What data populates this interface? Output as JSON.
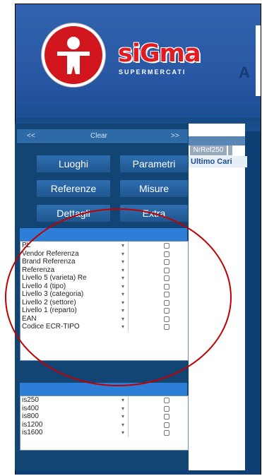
{
  "brand": {
    "name": "siGma",
    "tagline": "SUPERMERCATI"
  },
  "header_right_fragment": "A",
  "top_bar": {
    "prev": "<<",
    "clear": "Clear",
    "next": ">>"
  },
  "buttons": {
    "luoghi": "Luoghi",
    "parametri": "Parametri",
    "referenze": "Referenze",
    "misure": "Misure",
    "dettagli": "Dettagli",
    "extra": "Extra"
  },
  "dimensions": [
    "PL",
    "Vendor Referenza",
    "Brand Referenza",
    "Referenza",
    "Livello 5 (varieta) Re",
    "Livello 4 (tipo)",
    "Livello 3 (categoria)",
    "Livello 2 (settore)",
    "Livello 1 (reparto)",
    "EAN",
    "Codice ECR-TIPO"
  ],
  "measures": [
    "is250",
    "is400",
    "is800",
    "is1200",
    "is1600"
  ],
  "right_tab": "NrRef250",
  "right_sub": "Ultimo Cari",
  "colors": {
    "panel": "#124573",
    "button": "#2a639f",
    "accent_red": "#c00000"
  }
}
